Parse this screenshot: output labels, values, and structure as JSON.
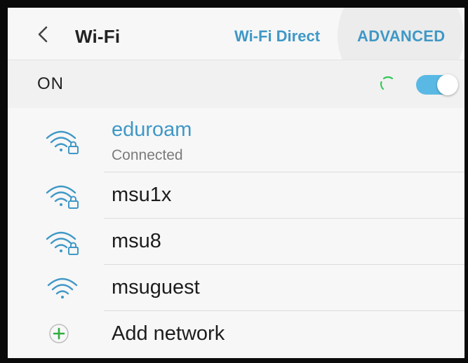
{
  "appbar": {
    "title": "Wi-Fi",
    "wifi_direct_label": "Wi-Fi Direct",
    "advanced_label": "ADVANCED",
    "back_icon": "chevron-left-icon"
  },
  "master_switch": {
    "label": "ON",
    "state": "on",
    "scanning": true
  },
  "networks": [
    {
      "name": "eduroam",
      "status": "Connected",
      "secured": true,
      "connected": true,
      "icon": "wifi-lock-icon"
    },
    {
      "name": "msu1x",
      "secured": true,
      "connected": false,
      "icon": "wifi-lock-icon"
    },
    {
      "name": "msu8",
      "secured": true,
      "connected": false,
      "icon": "wifi-lock-icon"
    },
    {
      "name": "msuguest",
      "secured": false,
      "connected": false,
      "icon": "wifi-icon"
    }
  ],
  "add_network": {
    "label": "Add network",
    "icon": "plus-circle-icon"
  },
  "colors": {
    "accent": "#3f98c6",
    "toggle": "#5ab9e4",
    "add_green": "#2fae3f",
    "spinner_green": "#34c759",
    "frame": "#0a0a0a"
  }
}
